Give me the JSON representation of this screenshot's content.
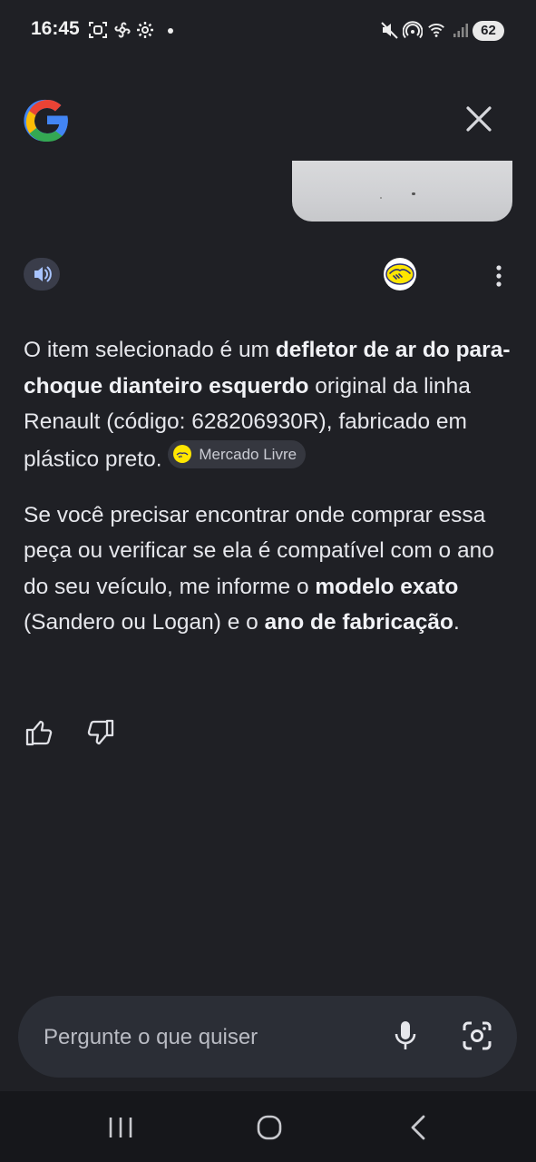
{
  "status_bar": {
    "time": "16:45",
    "battery": "62",
    "icons": [
      "screenshot-icon",
      "pinwheel-icon",
      "gear-icon",
      "notification-dot",
      "mute-icon",
      "hotspot-icon",
      "wifi-icon",
      "signal-icon"
    ]
  },
  "header": {
    "logo": "google-logo",
    "close_icon": "close-icon"
  },
  "response": {
    "p1_a": "O item selecionado é um ",
    "p1_b": "defletor de ar do para-choque dianteiro esquerdo",
    "p1_c": " original da linha Renault (código: 628206930R), fabricado em plástico preto. ",
    "source_chip": "Mercado Livre",
    "p2_a": "Se você precisar encontrar onde comprar essa peça ou verificar se ela é compatível com o ano do seu veículo, me informe o ",
    "p2_b": "modelo exato",
    "p2_c": " (Sandero ou Logan) e o ",
    "p2_d": "ano de fabricação",
    "p2_e": "."
  },
  "input": {
    "placeholder": "Pergunte o que quiser",
    "value": ""
  },
  "colors": {
    "background": "#1f2025",
    "input_bg": "#2b2e36",
    "chip_bg": "#35373f",
    "navbar_bg": "#16171b"
  }
}
